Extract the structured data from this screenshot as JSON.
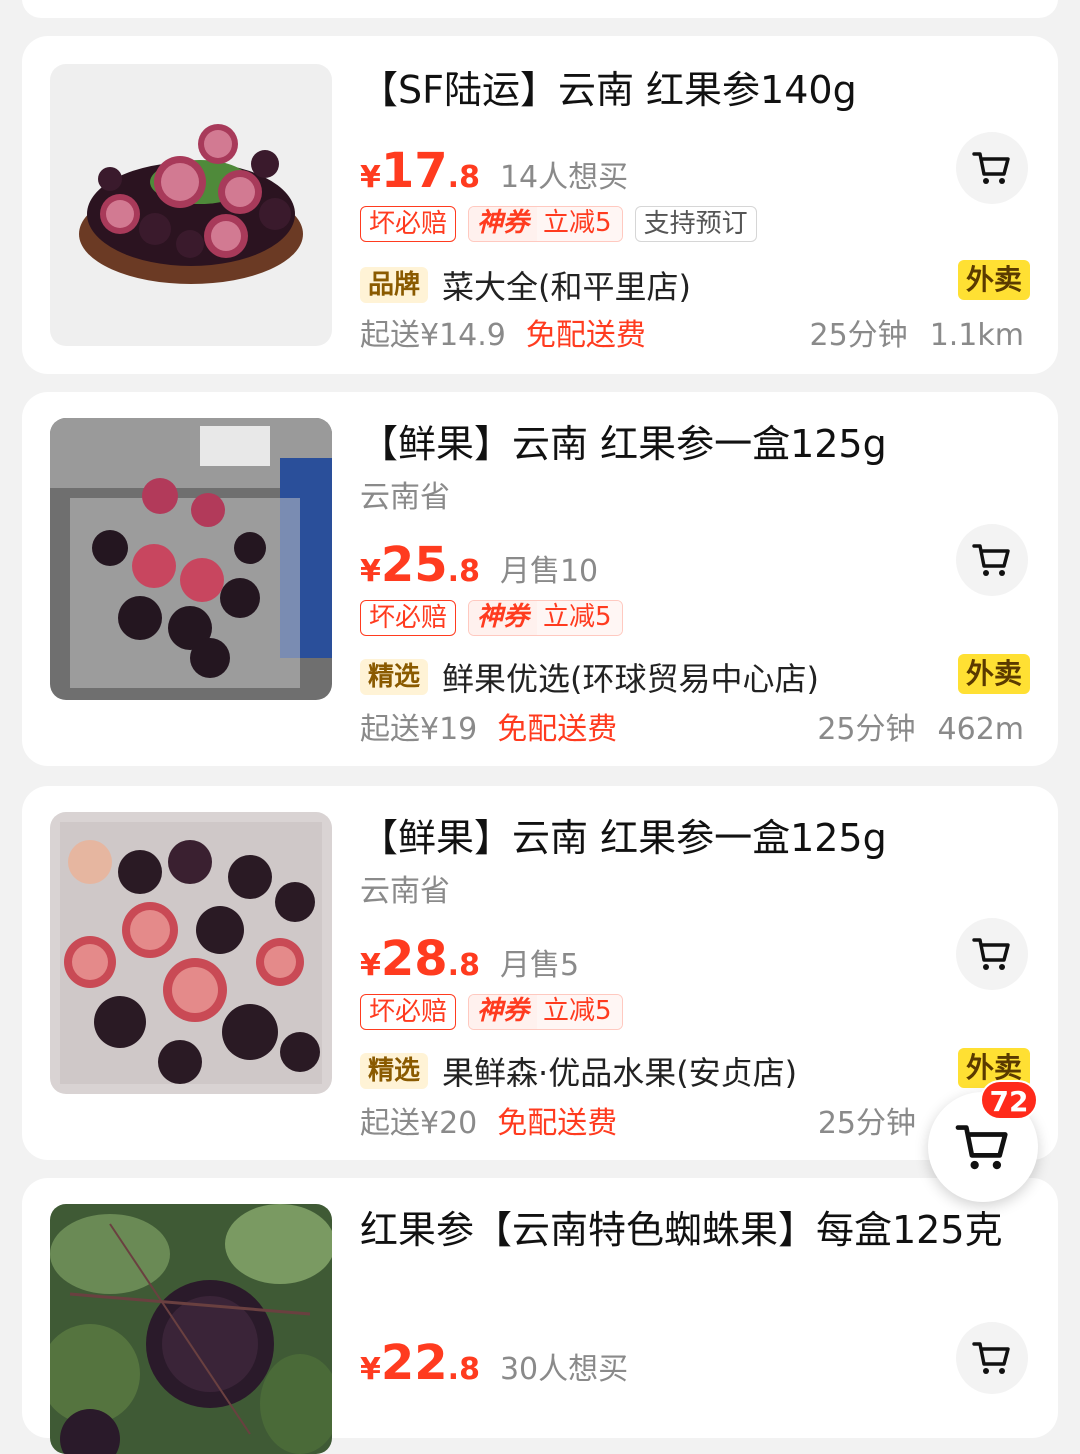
{
  "products": [
    {
      "title": "【SF陆运】云南 红果参140g",
      "origin": "",
      "price_yen": "¥",
      "price_int": "17",
      "price_dec": ".8",
      "sales": "14人想买",
      "tag_guarantee": "坏必赔",
      "coupon_label": "神券",
      "coupon_text": "立减5",
      "tag_extra": "支持预订",
      "store_badge": "品牌",
      "store_name": "菜大全(和平里店)",
      "waimai": "外卖",
      "min_order": "起送¥14.9",
      "free_delivery": "免配送费",
      "eta": "25分钟",
      "distance": "1.1km"
    },
    {
      "title": "【鲜果】云南 红果参一盒125g",
      "origin": "云南省",
      "price_yen": "¥",
      "price_int": "25",
      "price_dec": ".8",
      "sales": "月售10",
      "tag_guarantee": "坏必赔",
      "coupon_label": "神券",
      "coupon_text": "立减5",
      "store_badge": "精选",
      "store_name": "鲜果优选(环球贸易中心店)",
      "waimai": "外卖",
      "min_order": "起送¥19",
      "free_delivery": "免配送费",
      "eta": "25分钟",
      "distance": "462m"
    },
    {
      "title": "【鲜果】云南 红果参一盒125g",
      "origin": "云南省",
      "price_yen": "¥",
      "price_int": "28",
      "price_dec": ".8",
      "sales": "月售5",
      "tag_guarantee": "坏必赔",
      "coupon_label": "神券",
      "coupon_text": "立减5",
      "store_badge": "精选",
      "store_name": "果鲜森·优品水果(安贞店)",
      "waimai": "外卖",
      "min_order": "起送¥20",
      "free_delivery": "免配送费",
      "eta": "25分钟",
      "distance": ""
    },
    {
      "title": "红果参【云南特色蜘蛛果】每盒125克",
      "origin": "",
      "price_yen": "¥",
      "price_int": "22",
      "price_dec": ".8",
      "sales": "30人想买"
    }
  ],
  "floating_cart": {
    "count": "72"
  },
  "icons": {
    "cart": "cart-icon"
  },
  "colors": {
    "price_red": "#ff3b1f",
    "waimai_yellow": "#ffe033",
    "badge_red": "#ff2a1a"
  }
}
